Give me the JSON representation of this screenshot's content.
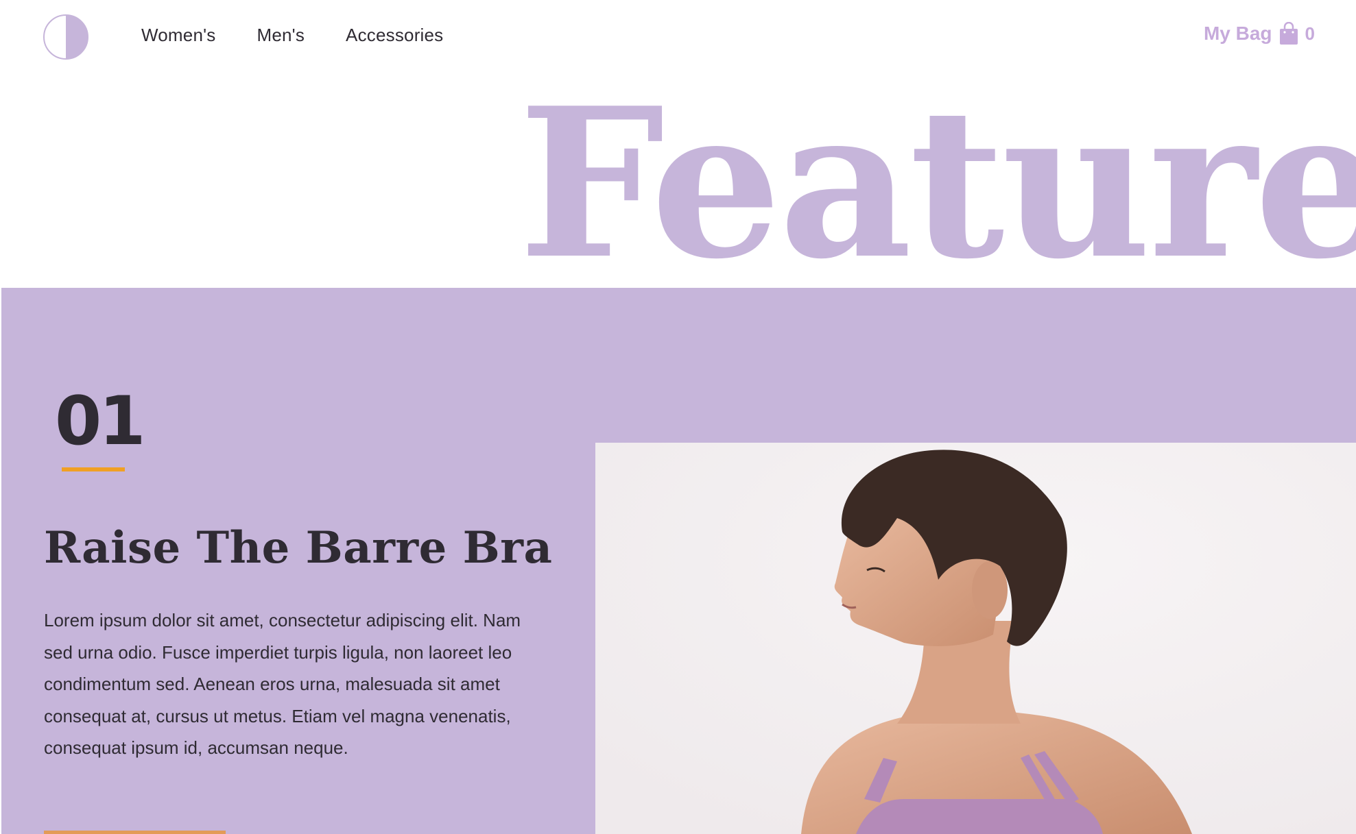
{
  "nav": {
    "links": [
      {
        "label": "Women's"
      },
      {
        "label": "Men's"
      },
      {
        "label": "Accessories"
      }
    ],
    "bag": {
      "label": "My Bag",
      "count": "0",
      "icon": "shopping-bag-icon"
    },
    "logo": {
      "icon": "half-circle-logo"
    }
  },
  "hero": {
    "heading": "Featured"
  },
  "feature": {
    "number": "01",
    "title": "Raise The Barre Bra",
    "description": "Lorem ipsum dolor sit amet, consectetur adipiscing elit. Nam sed urna odio. Fusce imperdiet turpis ligula, non laoreet leo condimentum sed. Aenean eros urna, malesuada sit amet consequat at, cursus ut metus. Etiam vel magna venenatis, consequat ipsum id, accumsan neque."
  },
  "colors": {
    "accent_purple": "#c6b5da",
    "bag_purple": "#c6aadb",
    "underline_orange": "#f0a024",
    "text_dark": "#2f2b33"
  }
}
